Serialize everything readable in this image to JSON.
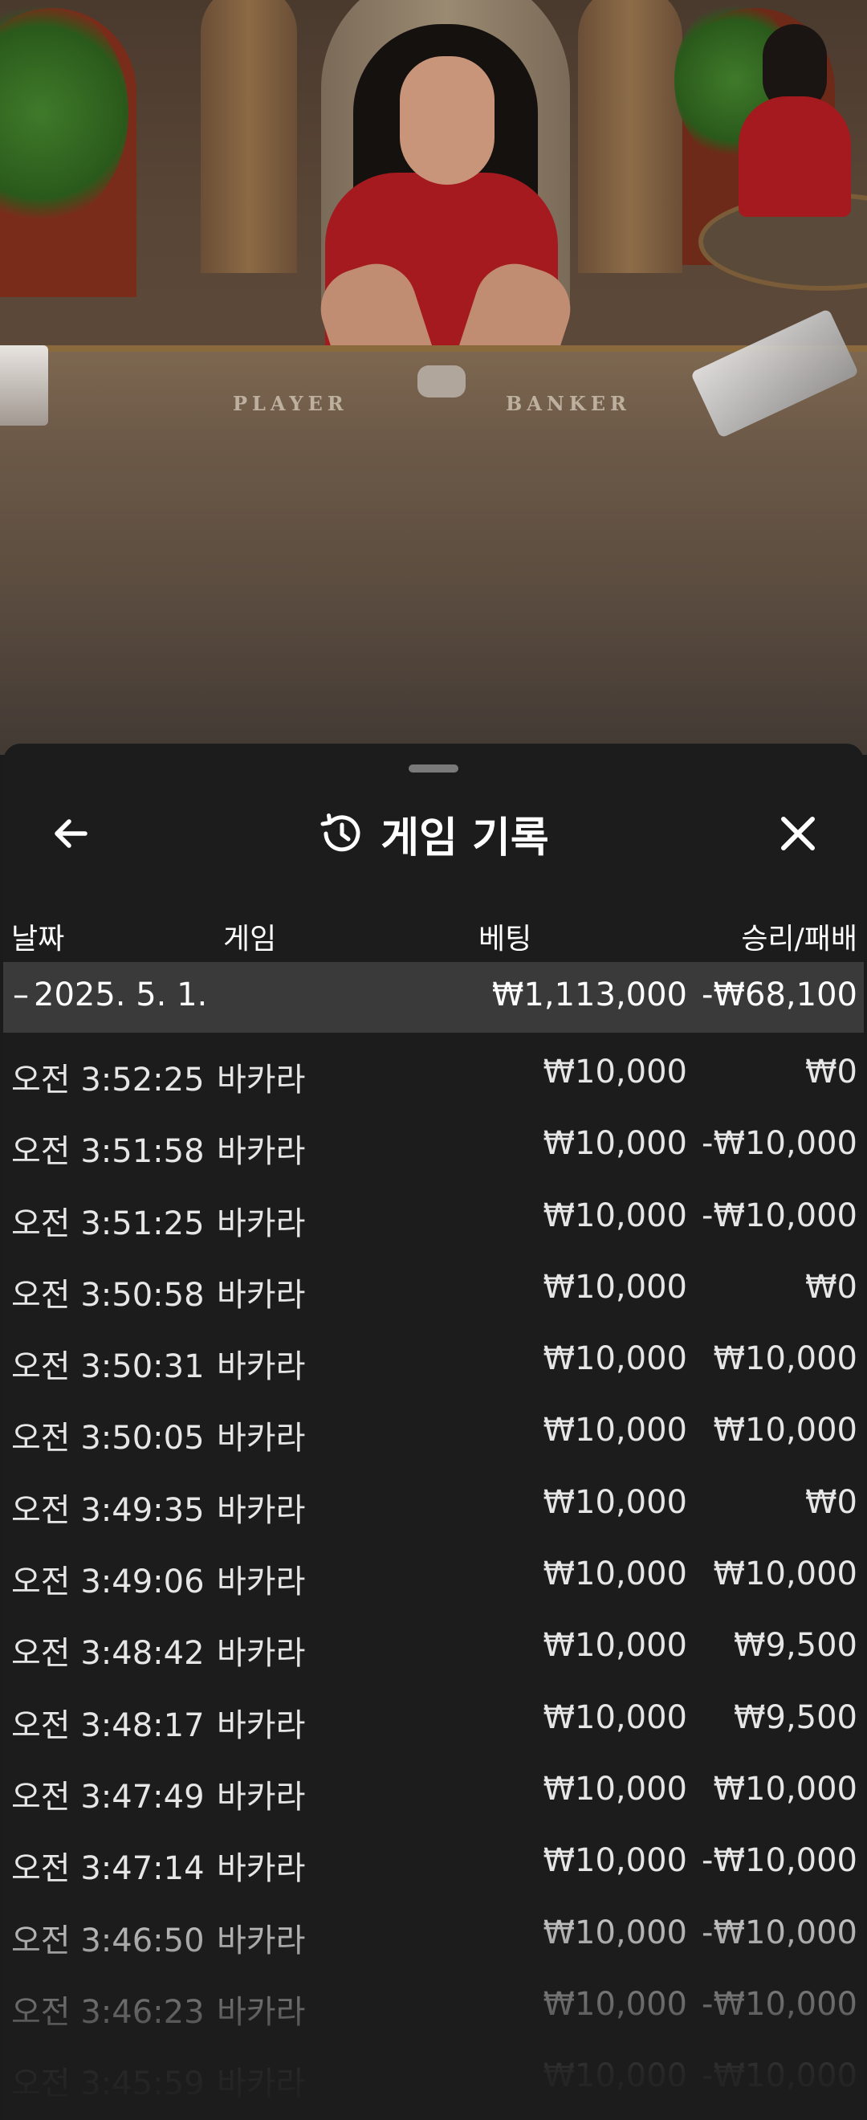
{
  "video": {
    "table_left_label": "PLAYER",
    "table_right_label": "BANKER"
  },
  "sheet": {
    "title": "게임 기록",
    "columns": {
      "date": "날짜",
      "game": "게임",
      "bet": "베팅",
      "win_loss": "승리/패배"
    },
    "date_group": {
      "toggle": "–",
      "date": "2025. 5. 1.",
      "total_bet": "₩1,113,000",
      "total_win_loss": "-₩68,100"
    },
    "rows": [
      {
        "time": "오전 3:52:25",
        "game": "바카라",
        "bet": "₩10,000",
        "win_loss": "₩0"
      },
      {
        "time": "오전 3:51:58",
        "game": "바카라",
        "bet": "₩10,000",
        "win_loss": "-₩10,000"
      },
      {
        "time": "오전 3:51:25",
        "game": "바카라",
        "bet": "₩10,000",
        "win_loss": "-₩10,000"
      },
      {
        "time": "오전 3:50:58",
        "game": "바카라",
        "bet": "₩10,000",
        "win_loss": "₩0"
      },
      {
        "time": "오전 3:50:31",
        "game": "바카라",
        "bet": "₩10,000",
        "win_loss": "₩10,000"
      },
      {
        "time": "오전 3:50:05",
        "game": "바카라",
        "bet": "₩10,000",
        "win_loss": "₩10,000"
      },
      {
        "time": "오전 3:49:35",
        "game": "바카라",
        "bet": "₩10,000",
        "win_loss": "₩0"
      },
      {
        "time": "오전 3:49:06",
        "game": "바카라",
        "bet": "₩10,000",
        "win_loss": "₩10,000"
      },
      {
        "time": "오전 3:48:42",
        "game": "바카라",
        "bet": "₩10,000",
        "win_loss": "₩9,500"
      },
      {
        "time": "오전 3:48:17",
        "game": "바카라",
        "bet": "₩10,000",
        "win_loss": "₩9,500"
      },
      {
        "time": "오전 3:47:49",
        "game": "바카라",
        "bet": "₩10,000",
        "win_loss": "₩10,000"
      },
      {
        "time": "오전 3:47:14",
        "game": "바카라",
        "bet": "₩10,000",
        "win_loss": "-₩10,000"
      },
      {
        "time": "오전 3:46:50",
        "game": "바카라",
        "bet": "₩10,000",
        "win_loss": "-₩10,000"
      },
      {
        "time": "오전 3:46:23",
        "game": "바카라",
        "bet": "₩10,000",
        "win_loss": "-₩10,000"
      },
      {
        "time": "오전 3:45:59",
        "game": "바카라",
        "bet": "₩10,000",
        "win_loss": "-₩10,000"
      }
    ]
  },
  "icons": {
    "back": "arrow-left-icon",
    "history": "history-clock-icon",
    "close": "close-icon"
  }
}
